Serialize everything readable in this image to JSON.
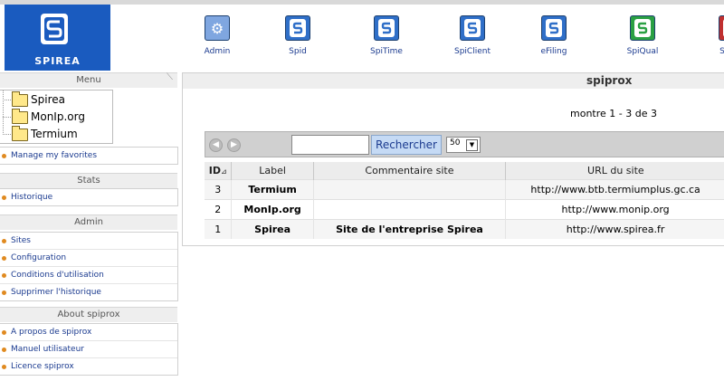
{
  "brand": {
    "name": "SPIREA",
    "color": "#1a5bbf"
  },
  "apps": [
    {
      "label": "Admin",
      "icon": "admin-cogs-icon",
      "color": "#7fa6e0"
    },
    {
      "label": "Spid",
      "icon": "spirea-s-icon",
      "color": "#2f6fc8"
    },
    {
      "label": "SpiTime",
      "icon": "spirea-s-icon",
      "color": "#2f6fc8"
    },
    {
      "label": "SpiClient",
      "icon": "spirea-s-icon",
      "color": "#2f6fc8"
    },
    {
      "label": "eFiling",
      "icon": "spirea-s-icon",
      "color": "#2f6fc8"
    },
    {
      "label": "SpiQual",
      "icon": "spirea-s-icon",
      "color": "#2aa043"
    },
    {
      "label": "SpiCa",
      "icon": "spirea-s-icon",
      "color": "#c03030"
    }
  ],
  "sidebar": {
    "menu_title": "Menu",
    "tree": [
      "Spirea",
      "MonIp.org",
      "Termium"
    ],
    "favorites": "Manage my favorites",
    "stats_title": "Stats",
    "stats_items": [
      "Historique"
    ],
    "admin_title": "Admin",
    "admin_items": [
      "Sites",
      "Configuration",
      "Conditions d'utilisation",
      "Supprimer l'historique"
    ],
    "about_title": "About spiprox",
    "about_items": [
      "A propos de spiprox",
      "Manuel utilisateur",
      "Licence spiprox"
    ]
  },
  "main": {
    "title": "spiprox",
    "count": "montre 1 - 3 de 3",
    "search_value": "",
    "search_button": "Rechercher",
    "page_size": "50",
    "columns": [
      "ID",
      "Label",
      "Commentaire site",
      "URL du site"
    ],
    "rows": [
      {
        "id": "3",
        "label": "Termium",
        "comment": "",
        "url": "http://www.btb.termiumplus.gc.ca"
      },
      {
        "id": "2",
        "label": "MonIp.org",
        "comment": "",
        "url": "http://www.monip.org"
      },
      {
        "id": "1",
        "label": "Spirea",
        "comment": "Site de l'entreprise Spirea",
        "url": "http://www.spirea.fr"
      }
    ]
  }
}
